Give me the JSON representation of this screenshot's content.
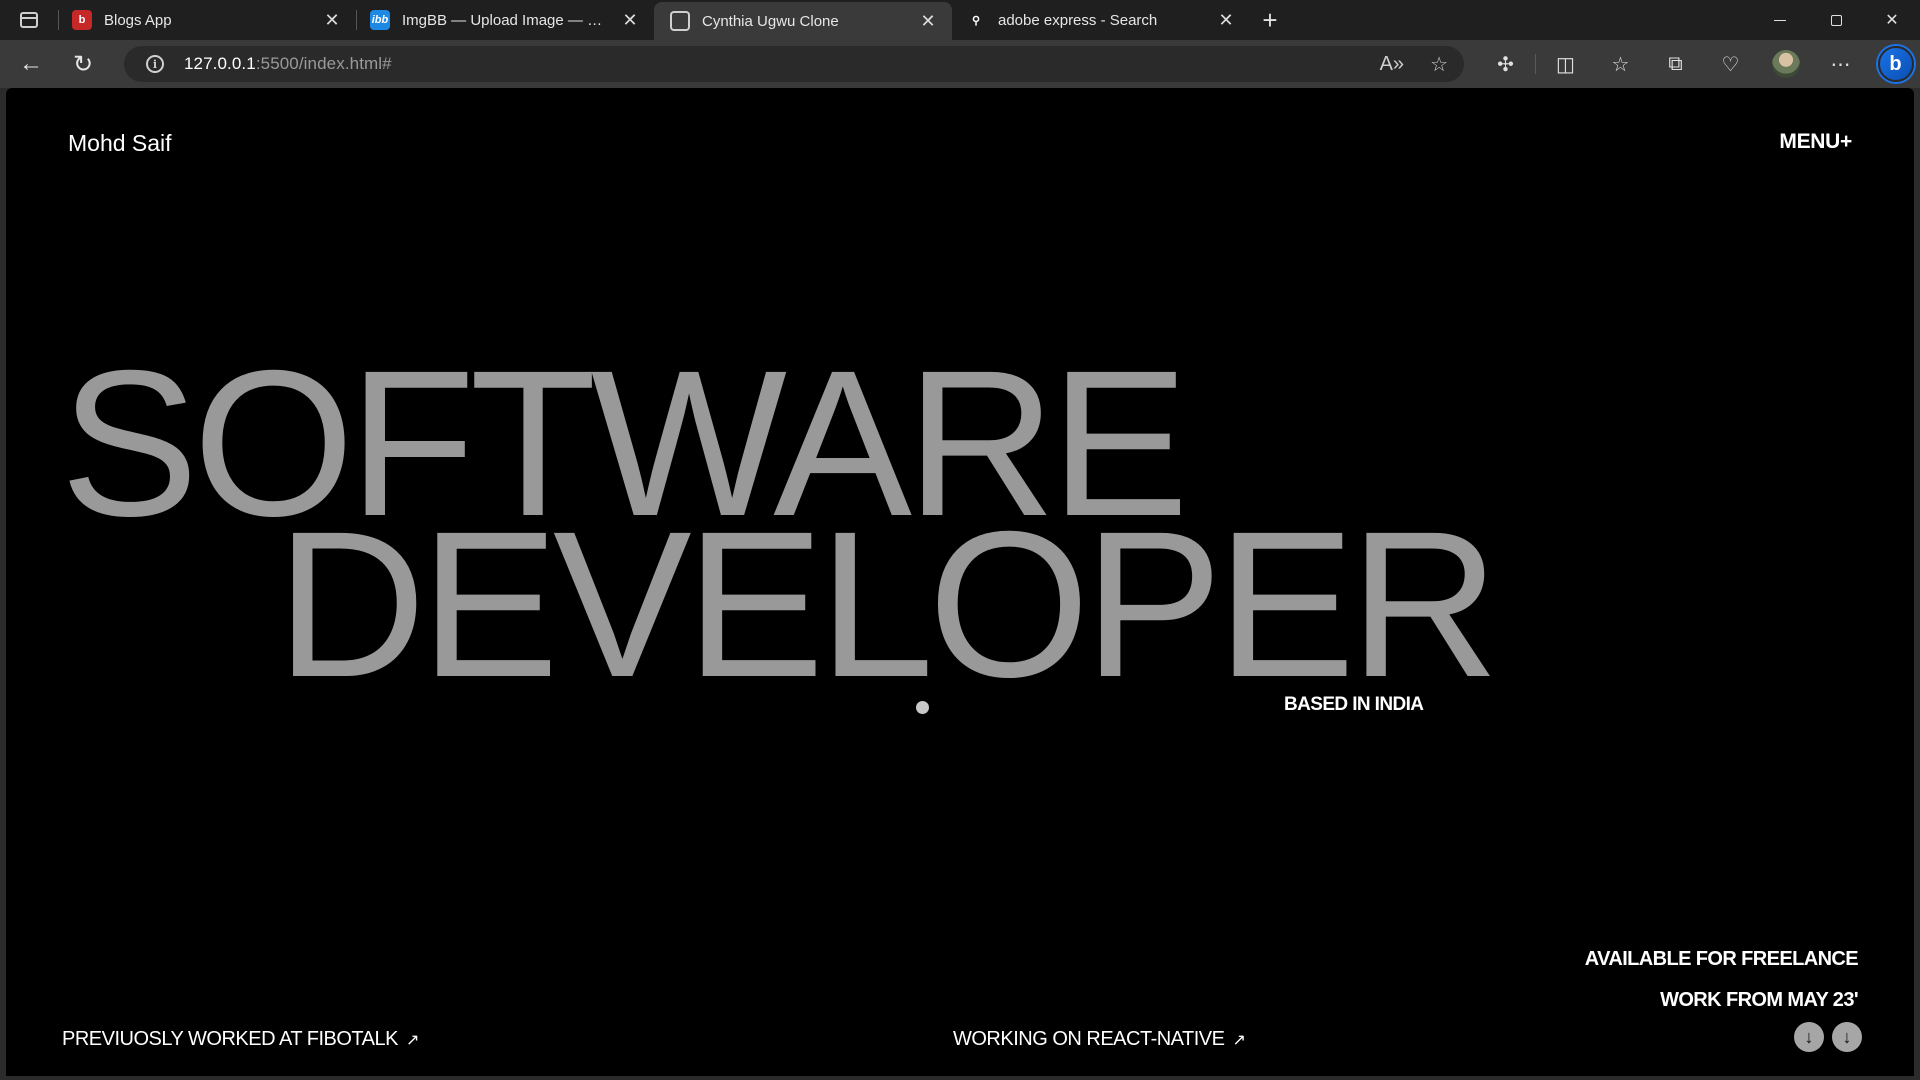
{
  "tabs": [
    {
      "title": "Blogs App",
      "icon": "blogs-app-favicon",
      "active": false
    },
    {
      "title": "ImgBB — Upload Image — Free Image Hosting",
      "icon": "imgbb-favicon",
      "active": false
    },
    {
      "title": "Cynthia Ugwu Clone",
      "icon": "page-icon",
      "active": true
    },
    {
      "title": "adobe express - Search",
      "icon": "search-icon",
      "active": false
    }
  ],
  "address_bar": {
    "url_host": "127.0.0.1",
    "url_rest": ":5500/index.html#"
  },
  "page": {
    "site_name": "Mohd Saif",
    "menu_label": "MENU+",
    "hero_line_1": "SOFTWARE",
    "hero_line_2": "DEVELOPER",
    "location": "BASED IN INDIA",
    "availability_line_1": "AVAILABLE FOR FREELANCE",
    "availability_line_2": "WORK FROM MAY 23'",
    "footer_link_1": "PREVIUOSLY WORKED AT FIBOTALK",
    "footer_link_2": "WORKING ON REACT-NATIVE",
    "arrow": "↗"
  },
  "colors": {
    "page_background": "#000000",
    "hero_text": "#999999",
    "text": "#ffffff",
    "browser_frame": "#1f1f1f",
    "toolbar": "#3a3a3a"
  }
}
